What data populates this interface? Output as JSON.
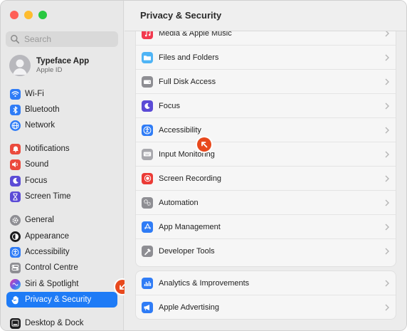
{
  "window": {
    "title": "Privacy & Security"
  },
  "sidebar": {
    "search_placeholder": "Search",
    "account": {
      "name": "Typeface App",
      "subtitle": "Apple ID"
    },
    "items": [
      {
        "label": "Wi-Fi",
        "icon": "wifi-icon",
        "color": "#2f7cf6"
      },
      {
        "label": "Bluetooth",
        "icon": "bluetooth-icon",
        "color": "#2f7cf6"
      },
      {
        "label": "Network",
        "icon": "globe-icon",
        "color": "#2f7cf6"
      },
      {
        "label": "Notifications",
        "icon": "bell-icon",
        "color": "#eb4a3d"
      },
      {
        "label": "Sound",
        "icon": "speaker-icon",
        "color": "#eb4a3d"
      },
      {
        "label": "Focus",
        "icon": "moon-icon",
        "color": "#5b4bd6"
      },
      {
        "label": "Screen Time",
        "icon": "hourglass-icon",
        "color": "#5b4bd6"
      },
      {
        "label": "General",
        "icon": "gear-icon",
        "color": "#8e8e93"
      },
      {
        "label": "Appearance",
        "icon": "appearance-icon",
        "color": "#1c1c1e"
      },
      {
        "label": "Accessibility",
        "icon": "accessibility-icon",
        "color": "#2f7cf6"
      },
      {
        "label": "Control Centre",
        "icon": "control-centre-icon",
        "color": "#8e8e93"
      },
      {
        "label": "Siri & Spotlight",
        "icon": "siri-icon",
        "color": "#a24bd8"
      },
      {
        "label": "Privacy & Security",
        "icon": "hand-icon",
        "color": "#2f7cf6",
        "selected": true
      },
      {
        "label": "Desktop & Dock",
        "icon": "dock-icon",
        "color": "#1c1c1e"
      }
    ]
  },
  "main": {
    "group1": [
      {
        "label": "Media & Apple Music",
        "icon": "music-icon",
        "color": "#f2394f"
      },
      {
        "label": "Files and Folders",
        "icon": "folder-icon",
        "color": "#4fb4f5"
      },
      {
        "label": "Full Disk Access",
        "icon": "disk-icon",
        "color": "#8e8e93"
      },
      {
        "label": "Focus",
        "icon": "moon-icon",
        "color": "#5b4bd6"
      },
      {
        "label": "Accessibility",
        "icon": "accessibility-icon",
        "color": "#2f7cf6"
      },
      {
        "label": "Input Monitoring",
        "icon": "keyboard-icon",
        "color": "#a8a8ad"
      },
      {
        "label": "Screen Recording",
        "icon": "record-icon",
        "color": "#eb3b36"
      },
      {
        "label": "Automation",
        "icon": "gears-icon",
        "color": "#8e8e93"
      },
      {
        "label": "App Management",
        "icon": "app-store-icon",
        "color": "#2f7cf6"
      },
      {
        "label": "Developer Tools",
        "icon": "hammer-icon",
        "color": "#8e8e93"
      }
    ],
    "group2": [
      {
        "label": "Analytics & Improvements",
        "icon": "chart-icon",
        "color": "#2f7cf6"
      },
      {
        "label": "Apple Advertising",
        "icon": "megaphone-icon",
        "color": "#2f7cf6"
      }
    ]
  },
  "annotations": {
    "badge_color": "#e8491d"
  }
}
